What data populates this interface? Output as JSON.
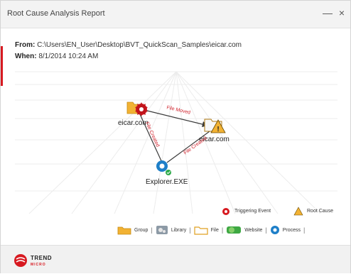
{
  "window": {
    "title": "Root Cause Analysis Report",
    "minimize_label": "—",
    "close_label": "×"
  },
  "info": {
    "from_label": "From:",
    "from_value": "C:\\Users\\EN_User\\Desktop\\BVT_QuickScan_Samples\\eicar.com",
    "when_label": "When:",
    "when_value": "8/1/2014 10:24 AM"
  },
  "graph": {
    "nodes": [
      {
        "id": "n1",
        "label": "eicar.com",
        "icon": "folder-trigger-icon"
      },
      {
        "id": "n2",
        "label": "eicar.com",
        "icon": "folder-root-cause-icon"
      },
      {
        "id": "n3",
        "label": "Explorer.EXE",
        "icon": "process-icon"
      }
    ],
    "edges": [
      {
        "label": "File Moved"
      },
      {
        "label": "File Created"
      },
      {
        "label": "File Created"
      }
    ]
  },
  "legend": {
    "triggering_event": "Triggering Event",
    "root_cause": "Root Cause",
    "group": "Group",
    "library": "Library",
    "file": "File",
    "website": "Website",
    "process": "Process",
    "separator": "|"
  },
  "footer": {
    "brand": "TREND",
    "brand_sub": "MICRO"
  },
  "colors": {
    "accent": "#d71920",
    "edge": "#d0202a",
    "folder": "#f2b233",
    "process": "#1e7fc8"
  }
}
